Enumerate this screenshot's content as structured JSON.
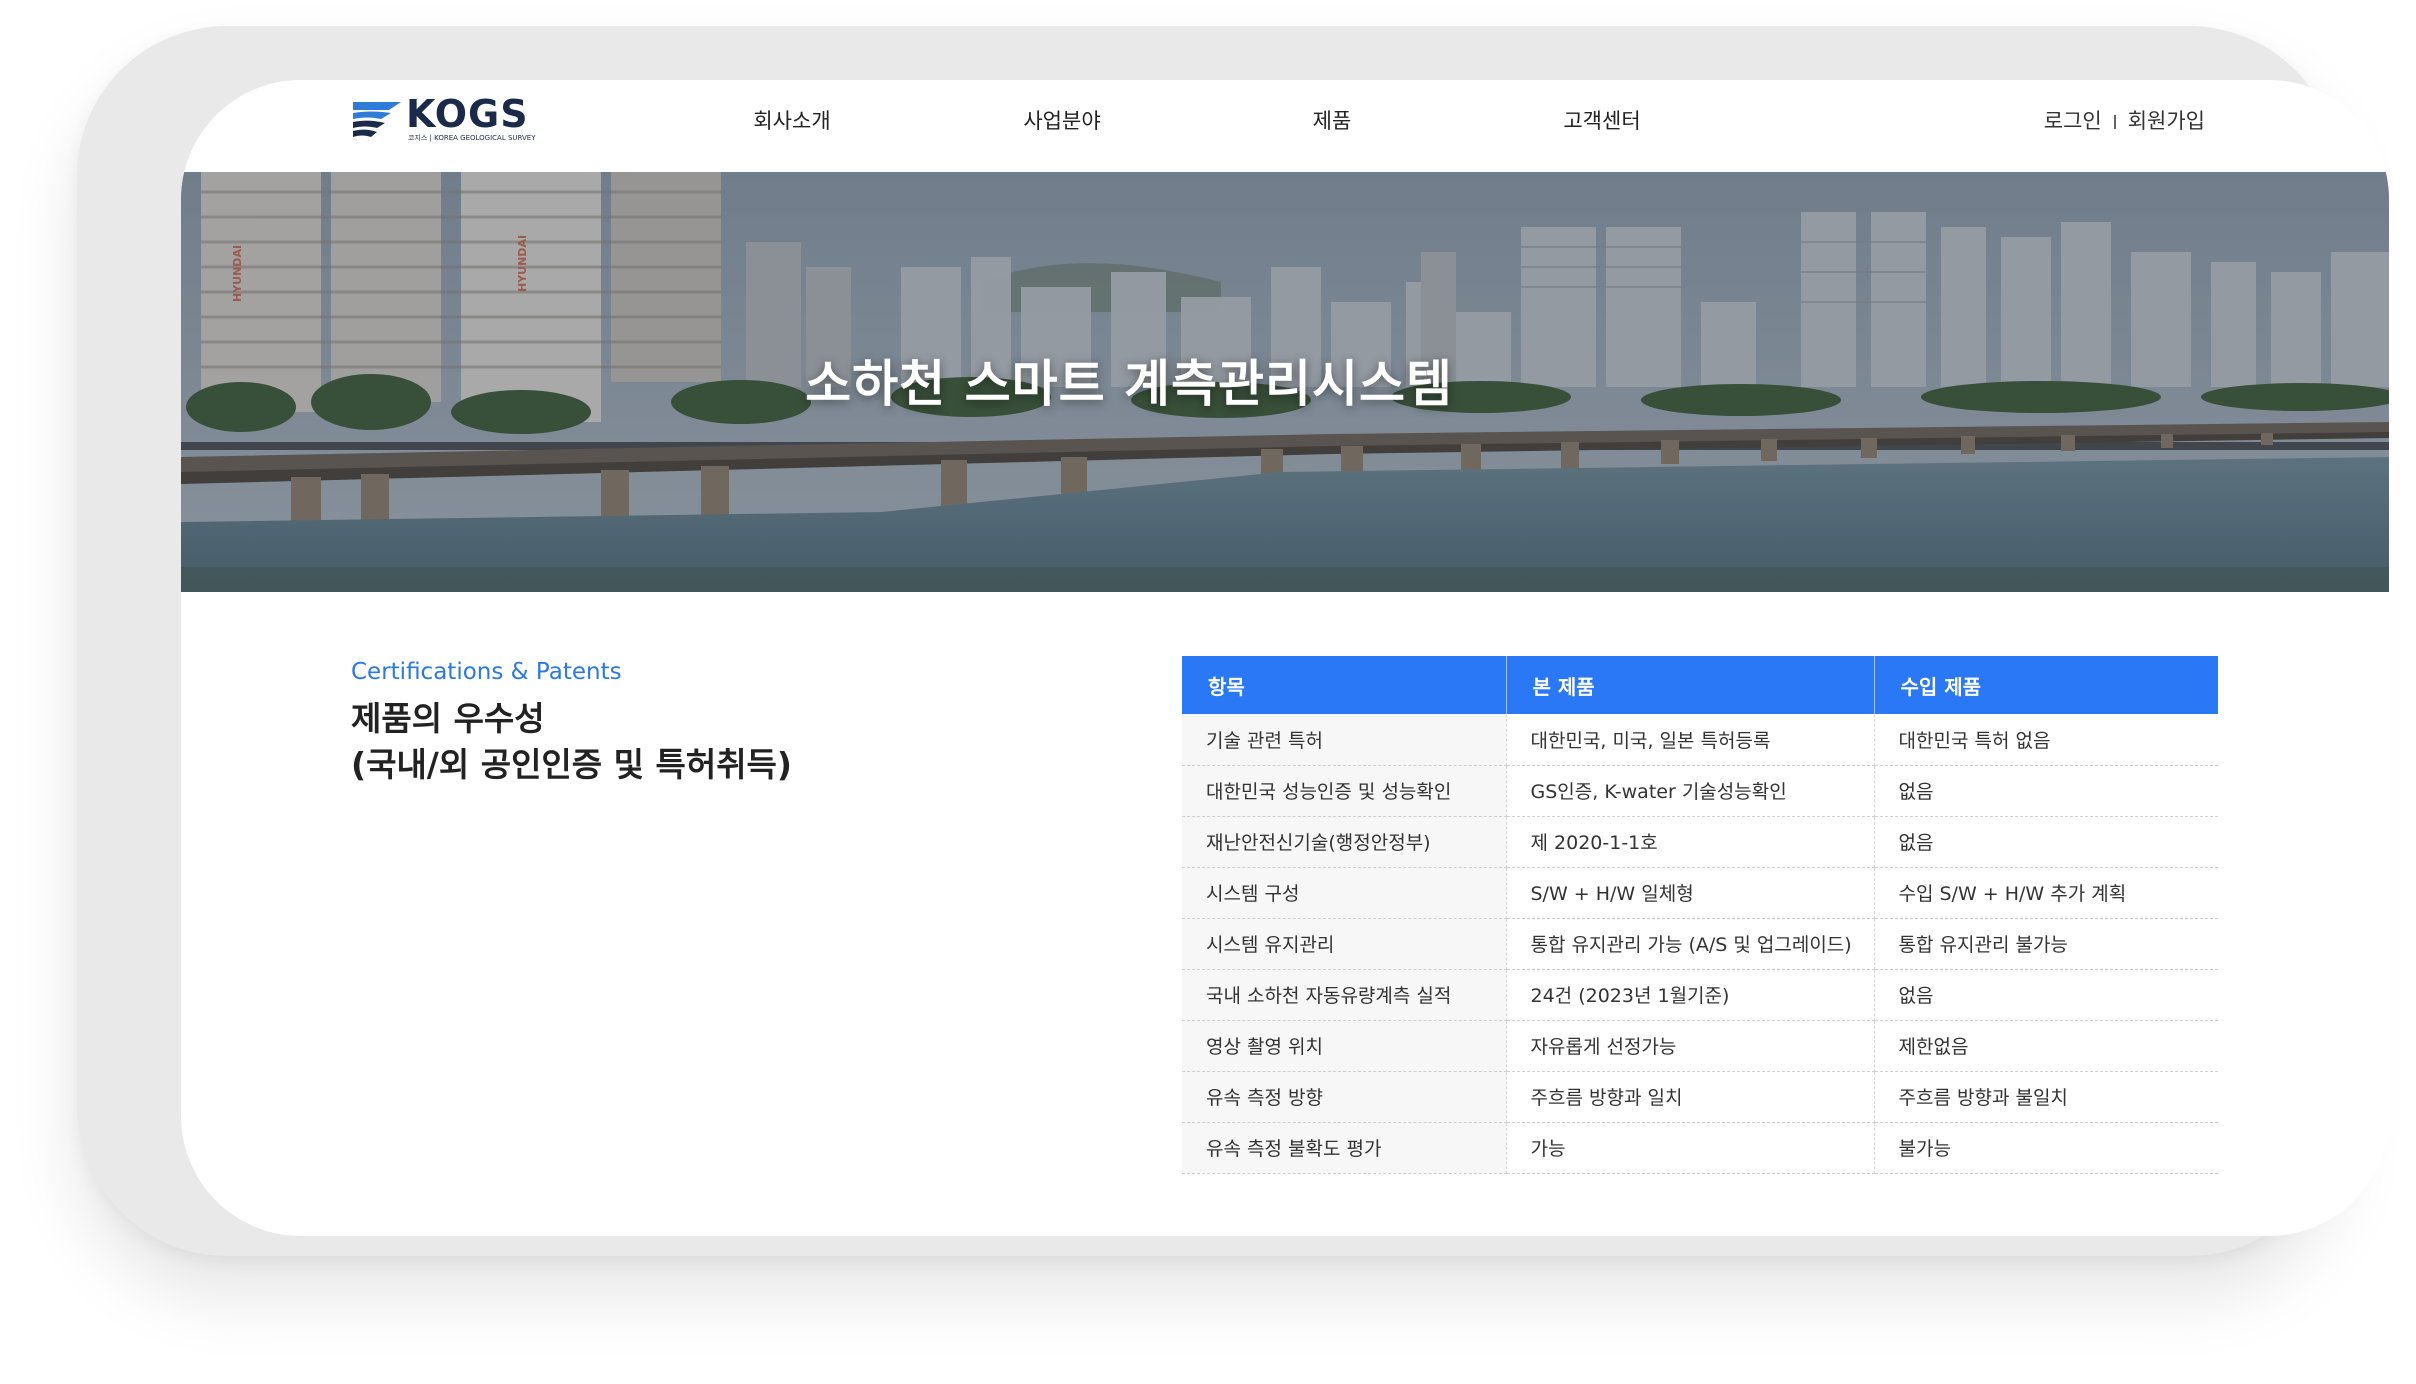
{
  "header": {
    "logo_text": "KOGS",
    "logo_sub": "코지스 | KOREA GEOLOGICAL SURVEY",
    "nav": [
      "회사소개",
      "사업분야",
      "제품",
      "고객센터"
    ],
    "login": "로그인",
    "signup": "회원가입"
  },
  "hero": {
    "title": "소하천 스마트 계측관리시스템",
    "building_text": "HYUNDAI"
  },
  "section": {
    "label": "Certifications & Patents",
    "title_line1": "제품의 우수성",
    "title_line2": "(국내/외 공인인증 및 특허취득)"
  },
  "table": {
    "headers": [
      "항목",
      "본 제품",
      "수입 제품"
    ],
    "rows": [
      [
        "기술 관련 특허",
        "대한민국, 미국, 일본 특허등록",
        "대한민국 특허 없음"
      ],
      [
        "대한민국 성능인증 및 성능확인",
        "GS인증, K-water 기술성능확인",
        "없음"
      ],
      [
        "재난안전신기술(행정안정부)",
        "제 2020-1-1호",
        "없음"
      ],
      [
        "시스템 구성",
        "S/W + H/W 일체형",
        "수입 S/W + H/W 추가 계획"
      ],
      [
        "시스템 유지관리",
        "통합 유지관리 가능 (A/S 및 업그레이드)",
        "통합 유지관리 불가능"
      ],
      [
        "국내 소하천 자동유량계측 실적",
        "24건 (2023년 1월기준)",
        "없음"
      ],
      [
        "영상 촬영 위치",
        "자유롭게 선정가능",
        "제한없음"
      ],
      [
        "유속 측정 방향",
        "주흐름 방향과 일치",
        "주흐름 방향과 불일치"
      ],
      [
        "유속 측정 불확도 평가",
        "가능",
        "불가능"
      ]
    ]
  },
  "colors": {
    "accent": "#2b78f6",
    "label_blue": "#2b78e4",
    "logo_navy": "#1c2a4a",
    "device_frame": "#e9e9ea"
  }
}
